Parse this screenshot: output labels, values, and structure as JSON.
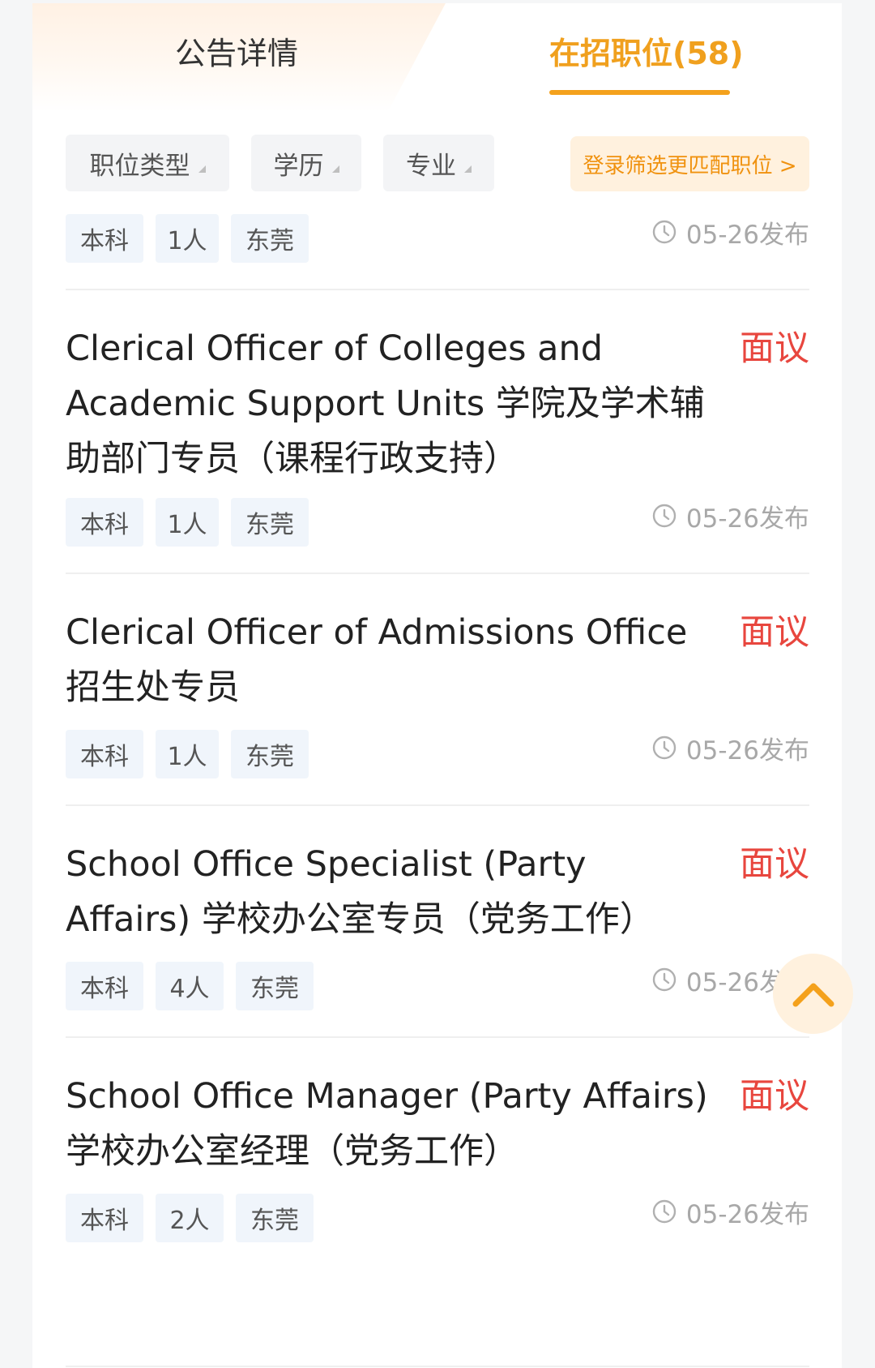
{
  "tabs": {
    "notice": "公告详情",
    "jobs": "在招职位(58)"
  },
  "filters": {
    "type": "职位类型",
    "education": "学历",
    "major": "专业",
    "login_cta": "登录筛选更匹配职位 >"
  },
  "jobs": [
    {
      "title": "",
      "salary": "",
      "tags": [
        "本科",
        "1人",
        "东莞"
      ],
      "published": "05-26发布"
    },
    {
      "title": "Clerical Officer of Colleges and Academic Support Units 学院及学术辅助部门专员（课程行政支持）",
      "salary": "面议",
      "tags": [
        "本科",
        "1人",
        "东莞"
      ],
      "published": "05-26发布"
    },
    {
      "title": "Clerical Officer of Admissions Office 招生处专员",
      "salary": "面议",
      "tags": [
        "本科",
        "1人",
        "东莞"
      ],
      "published": "05-26发布"
    },
    {
      "title": "School Office Specialist (Party Affairs) 学校办公室专员（党务工作）",
      "salary": "面议",
      "tags": [
        "本科",
        "4人",
        "东莞"
      ],
      "published": "05-26发布"
    },
    {
      "title": "School Office Manager (Party Affairs) 学校办公室经理（党务工作）",
      "salary": "面议",
      "tags": [
        "本科",
        "2人",
        "东莞"
      ],
      "published": "05-26发布"
    }
  ],
  "icons": {
    "clock": "clock-icon",
    "back_to_top": "chevron-up-icon",
    "filter_arrow": "triangle-icon"
  },
  "colors": {
    "accent": "#f4a11c",
    "salary": "#e8463e",
    "tag_bg": "#f0f5fb"
  }
}
